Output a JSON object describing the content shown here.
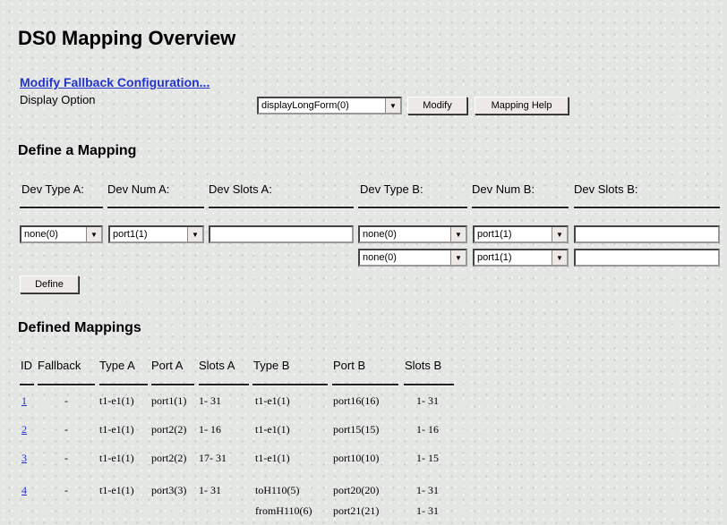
{
  "page_title": "DS0 Mapping Overview",
  "fallback_link": "Modify Fallback Configuration...",
  "display_option": {
    "label": "Display Option",
    "selected": "displayLongForm(0)",
    "modify_label": "Modify",
    "help_label": "Mapping Help"
  },
  "define": {
    "heading": "Define a Mapping",
    "col_a_type": "Dev Type A:",
    "col_a_num": "Dev Num A:",
    "col_a_slots": "Dev Slots A:",
    "col_b_type": "Dev Type B:",
    "col_b_num": "Dev Num B:",
    "col_b_slots": "Dev Slots B:",
    "type_a": "none(0)",
    "num_a": "port1(1)",
    "type_b1": "none(0)",
    "num_b1": "port1(1)",
    "type_b2": "none(0)",
    "num_b2": "port1(1)",
    "define_label": "Define"
  },
  "defined": {
    "heading": "Defined Mappings",
    "headers": [
      "ID",
      "Fallback",
      "Type A",
      "Port A",
      "Slots A",
      "Type B",
      "Port B",
      "Slots B"
    ],
    "rows": [
      {
        "id": "1",
        "fallback": "-",
        "type_a": "t1-e1(1)",
        "port_a": "port1(1)",
        "slots_a": "1- 31",
        "type_b": "t1-e1(1)",
        "port_b": "port16(16)",
        "slots_b": "1- 31"
      },
      {
        "id": "2",
        "fallback": "-",
        "type_a": "t1-e1(1)",
        "port_a": "port2(2)",
        "slots_a": "1- 16",
        "type_b": "t1-e1(1)",
        "port_b": "port15(15)",
        "slots_b": "1- 16"
      },
      {
        "id": "3",
        "fallback": "-",
        "type_a": "t1-e1(1)",
        "port_a": "port2(2)",
        "slots_a": "17- 31",
        "type_b": "t1-e1(1)",
        "port_b": "port10(10)",
        "slots_b": "1- 15"
      },
      {
        "id": "4",
        "fallback": "-",
        "type_a": "t1-e1(1)",
        "port_a": "port3(3)",
        "slots_a": "1- 31",
        "type_b": "toH110(5)",
        "port_b": "port20(20)",
        "slots_b": "1- 31"
      }
    ],
    "extra_row": {
      "type_b": "fromH110(6)",
      "port_b": "port21(21)",
      "slots_b": "1- 31"
    }
  }
}
